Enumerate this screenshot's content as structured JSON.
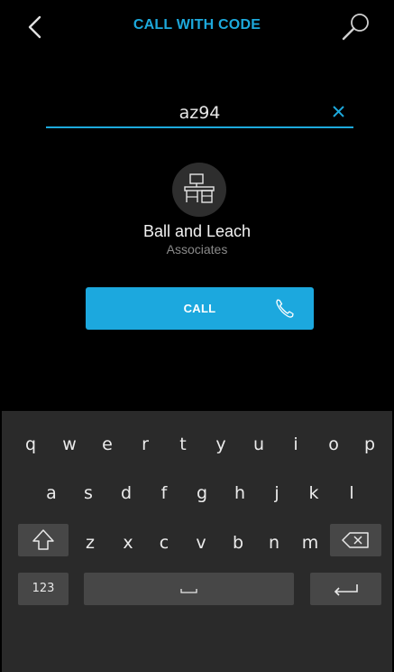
{
  "header": {
    "title": "CALL WITH CODE",
    "back_icon": "chevron-left-icon",
    "search_icon": "search-icon"
  },
  "code_field": {
    "value": "az94",
    "clear_icon": "close-icon"
  },
  "result": {
    "icon": "office-desk-icon",
    "name": "Ball and Leach",
    "subtitle": "Associates"
  },
  "call_button": {
    "label": "CALL",
    "icon": "phone-icon"
  },
  "keyboard": {
    "row1": [
      "q",
      "w",
      "e",
      "r",
      "t",
      "y",
      "u",
      "i",
      "o",
      "p"
    ],
    "row2": [
      "a",
      "s",
      "d",
      "f",
      "g",
      "h",
      "j",
      "k",
      "l"
    ],
    "row3": [
      "z",
      "x",
      "c",
      "v",
      "b",
      "n",
      "m"
    ],
    "numbers_label": "123",
    "space_icon": "space-icon",
    "shift_icon": "shift-icon",
    "backspace_icon": "backspace-icon",
    "enter_icon": "enter-icon"
  },
  "colors": {
    "accent": "#1da9dc",
    "background": "#000000",
    "keyboard": "#2a2a2a",
    "key_dark": "#474747"
  }
}
